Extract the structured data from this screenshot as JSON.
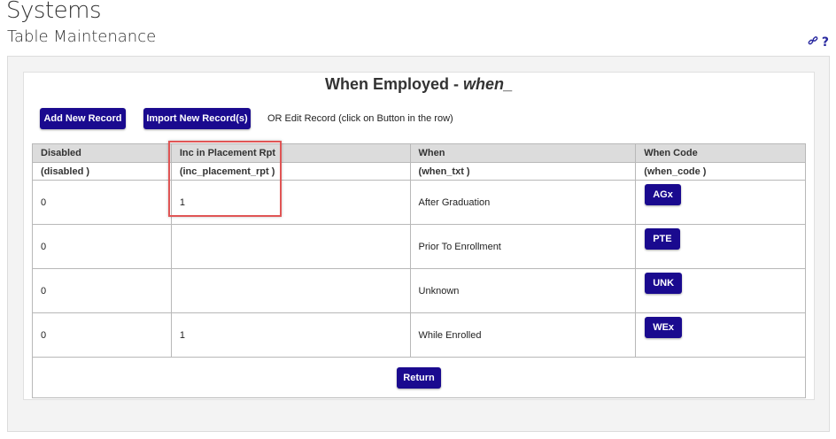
{
  "header": {
    "title": "Systems",
    "subtitle": "Table Maintenance",
    "link_icon": "link-icon",
    "help_icon": "?"
  },
  "panel": {
    "title_prefix": "When Employed - ",
    "title_table": "when_",
    "add_label": "Add New Record",
    "import_label": "Import New Record(s)",
    "edit_hint": "OR Edit Record (click on Button in the row)",
    "return_label": "Return"
  },
  "table": {
    "headers": [
      "Disabled",
      "Inc in Placement Rpt",
      "When",
      "When Code"
    ],
    "fields": [
      "(disabled )",
      "(inc_placement_rpt )",
      "(when_txt )",
      "(when_code )"
    ],
    "rows": [
      {
        "disabled": "0",
        "inc": "1",
        "when": "After Graduation",
        "code": "AGx"
      },
      {
        "disabled": "0",
        "inc": "",
        "when": "Prior To Enrollment",
        "code": "PTE"
      },
      {
        "disabled": "0",
        "inc": "",
        "when": "Unknown",
        "code": "UNK"
      },
      {
        "disabled": "0",
        "inc": "1",
        "when": "While Enrolled",
        "code": "WEx"
      }
    ]
  },
  "colors": {
    "button": "#1a0a8f",
    "highlight": "#e05555",
    "header_bg": "#dcdcdc"
  }
}
